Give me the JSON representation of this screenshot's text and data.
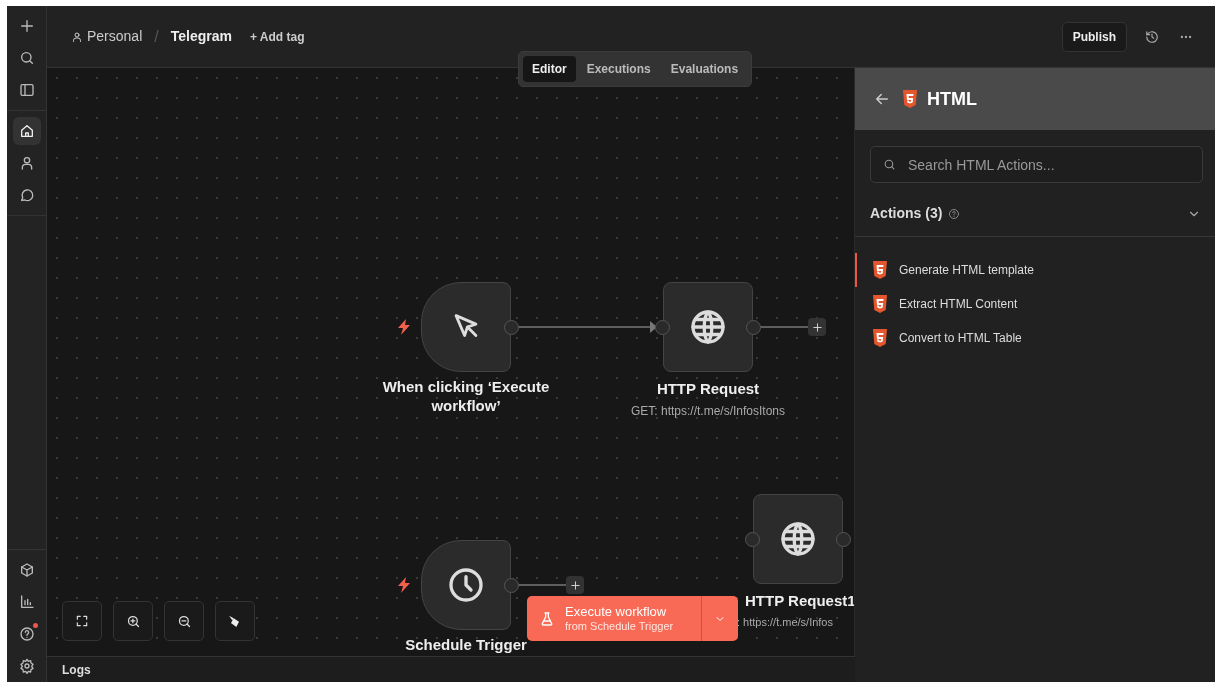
{
  "sidebar": {
    "top": [
      {
        "kind": "add",
        "selected": false,
        "notification": false
      },
      {
        "kind": "search",
        "selected": false,
        "notification": false
      },
      {
        "kind": "panel",
        "selected": false,
        "notification": false
      }
    ],
    "middle": [
      {
        "kind": "home",
        "selected": true,
        "notification": false
      },
      {
        "kind": "user",
        "selected": false,
        "notification": false
      },
      {
        "kind": "chat",
        "selected": false,
        "notification": false
      }
    ],
    "bottom": [
      {
        "kind": "cube",
        "selected": false,
        "notification": false
      },
      {
        "kind": "chart",
        "selected": false,
        "notification": false
      },
      {
        "kind": "help",
        "selected": false,
        "notification": true
      },
      {
        "kind": "settings",
        "selected": false,
        "notification": false
      }
    ]
  },
  "breadcrumb": {
    "owner": "Personal",
    "separator": "/",
    "workflow": "Telegram",
    "add_tag": "+ Add tag"
  },
  "header_actions": {
    "publish": "Publish"
  },
  "view_tabs": [
    {
      "label": "Editor",
      "selected": true
    },
    {
      "label": "Executions",
      "selected": false
    },
    {
      "label": "Evaluations",
      "selected": false
    }
  ],
  "nodes": [
    {
      "kind": "manual_trigger",
      "title": "When clicking ‘Execute workflow’",
      "trigger": true
    },
    {
      "kind": "http",
      "title": "HTTP Request",
      "subtitle": "GET: https://t.me/s/InfosItons",
      "trigger": false
    },
    {
      "kind": "schedule_trigger",
      "title": "Schedule Trigger",
      "trigger": true
    },
    {
      "kind": "http",
      "title": "HTTP Request1",
      "subtitle": ": https://t.me/s/Infos",
      "trigger": false
    }
  ],
  "execute_button": {
    "label": "Execute workflow",
    "sublabel": "from Schedule Trigger"
  },
  "logs": {
    "title": "Logs"
  },
  "panel": {
    "title": "HTML",
    "search_placeholder": "Search HTML Actions...",
    "section_title": "Actions (3)",
    "expanded": true,
    "actions": [
      {
        "label": "Generate HTML template",
        "selected": true
      },
      {
        "label": "Extract HTML Content",
        "selected": false
      },
      {
        "label": "Convert to HTML Table",
        "selected": false
      }
    ]
  }
}
